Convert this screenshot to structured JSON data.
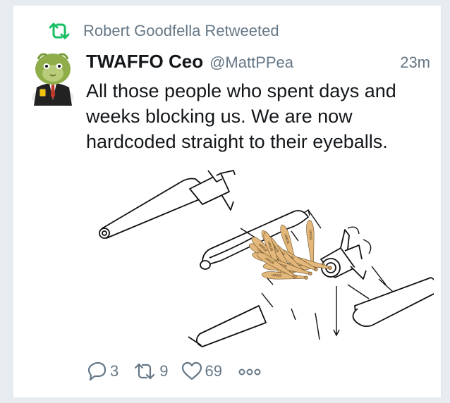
{
  "retweet_banner": {
    "icon": "retweet-icon",
    "text": "Robert Goodfella Retweeted",
    "color": "#17bf63"
  },
  "tweet": {
    "author_name": "TWAFFO Ceo",
    "author_handle": "@MattPPea",
    "timestamp": "23m",
    "text": "All those people who spent days and weeks blocking us. We are now hardcoded straight to their eyeballs.",
    "media": {
      "bat_label": "BONK!"
    }
  },
  "actions": {
    "reply_count": "3",
    "retweet_count": "9",
    "like_count": "69",
    "more_icon": "more-dots-icon"
  },
  "colors": {
    "secondary_text": "#657786",
    "primary_text": "#14171a",
    "retweet_green": "#17bf63",
    "background": "#e6ecf0"
  }
}
